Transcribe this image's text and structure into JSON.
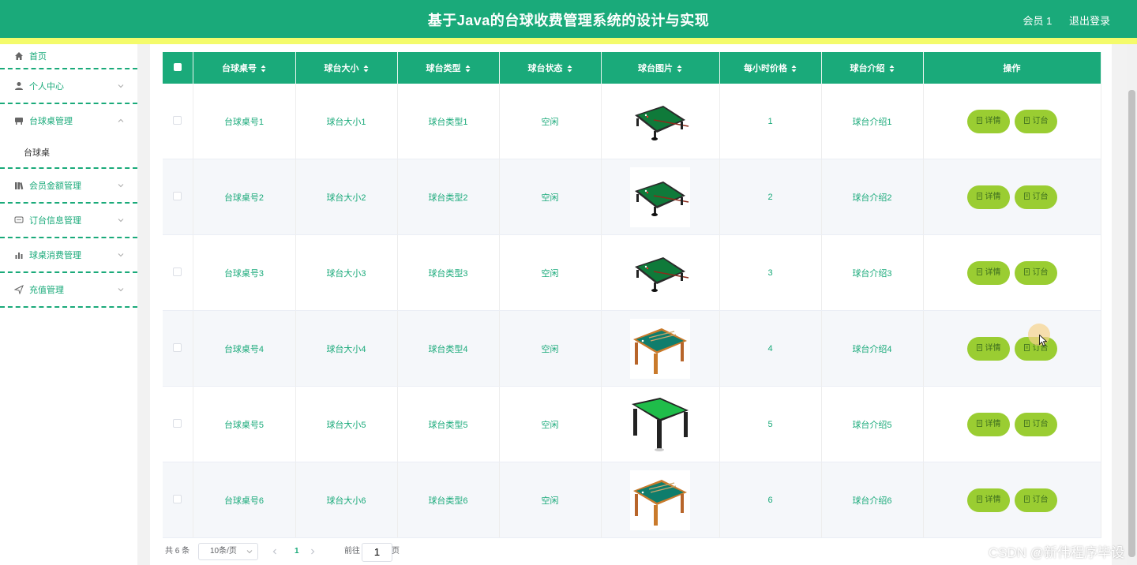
{
  "header": {
    "title": "基于Java的台球收费管理系统的设计与实现",
    "user_label": "会员 1",
    "logout_label": "退出登录"
  },
  "sidebar": {
    "items": [
      {
        "label": "首页",
        "icon": "home-icon"
      },
      {
        "label": "个人中心",
        "icon": "user-icon"
      },
      {
        "label": "台球桌管理",
        "icon": "table-icon",
        "expanded": true
      },
      {
        "label": "会员金额管理",
        "icon": "library-icon"
      },
      {
        "label": "订台信息管理",
        "icon": "chat-icon"
      },
      {
        "label": "球桌消费管理",
        "icon": "bar-chart-icon"
      },
      {
        "label": "充值管理",
        "icon": "send-icon"
      }
    ],
    "sub_items": [
      {
        "label": "台球桌"
      }
    ]
  },
  "table": {
    "columns": [
      "台球桌号",
      "球台大小",
      "球台类型",
      "球台状态",
      "球台图片",
      "每小时价格",
      "球台介绍",
      "操作"
    ],
    "rows": [
      {
        "number": "台球桌号1",
        "size": "球台大小1",
        "type": "球台类型1",
        "status": "空闲",
        "price": "1",
        "intro": "球台介绍1",
        "image": "billiard-table-black"
      },
      {
        "number": "台球桌号2",
        "size": "球台大小2",
        "type": "球台类型2",
        "status": "空闲",
        "price": "2",
        "intro": "球台介绍2",
        "image": "billiard-table-black"
      },
      {
        "number": "台球桌号3",
        "size": "球台大小3",
        "type": "球台类型3",
        "status": "空闲",
        "price": "3",
        "intro": "球台介绍3",
        "image": "billiard-table-black"
      },
      {
        "number": "台球桌号4",
        "size": "球台大小4",
        "type": "球台类型4",
        "status": "空闲",
        "price": "4",
        "intro": "球台介绍4",
        "image": "billiard-table-wood"
      },
      {
        "number": "台球桌号5",
        "size": "球台大小5",
        "type": "球台类型5",
        "status": "空闲",
        "price": "5",
        "intro": "球台介绍5",
        "image": "billiard-table-green"
      },
      {
        "number": "台球桌号6",
        "size": "球台大小6",
        "type": "球台类型6",
        "status": "空闲",
        "price": "6",
        "intro": "球台介绍6",
        "image": "billiard-table-wood"
      }
    ],
    "actions": {
      "detail_label": "详情",
      "book_label": "订台"
    }
  },
  "pagination": {
    "total_label": "共 6 条",
    "page_size_label": "10条/页",
    "current_page": "1",
    "goto_prefix": "前往",
    "goto_value": "1",
    "goto_suffix": "页"
  },
  "watermark": "CSDN @新伟程序毕设",
  "colors": {
    "primary": "#1aaa7a",
    "accent_bar": "#f4fb6b",
    "button": "#9acd32"
  }
}
